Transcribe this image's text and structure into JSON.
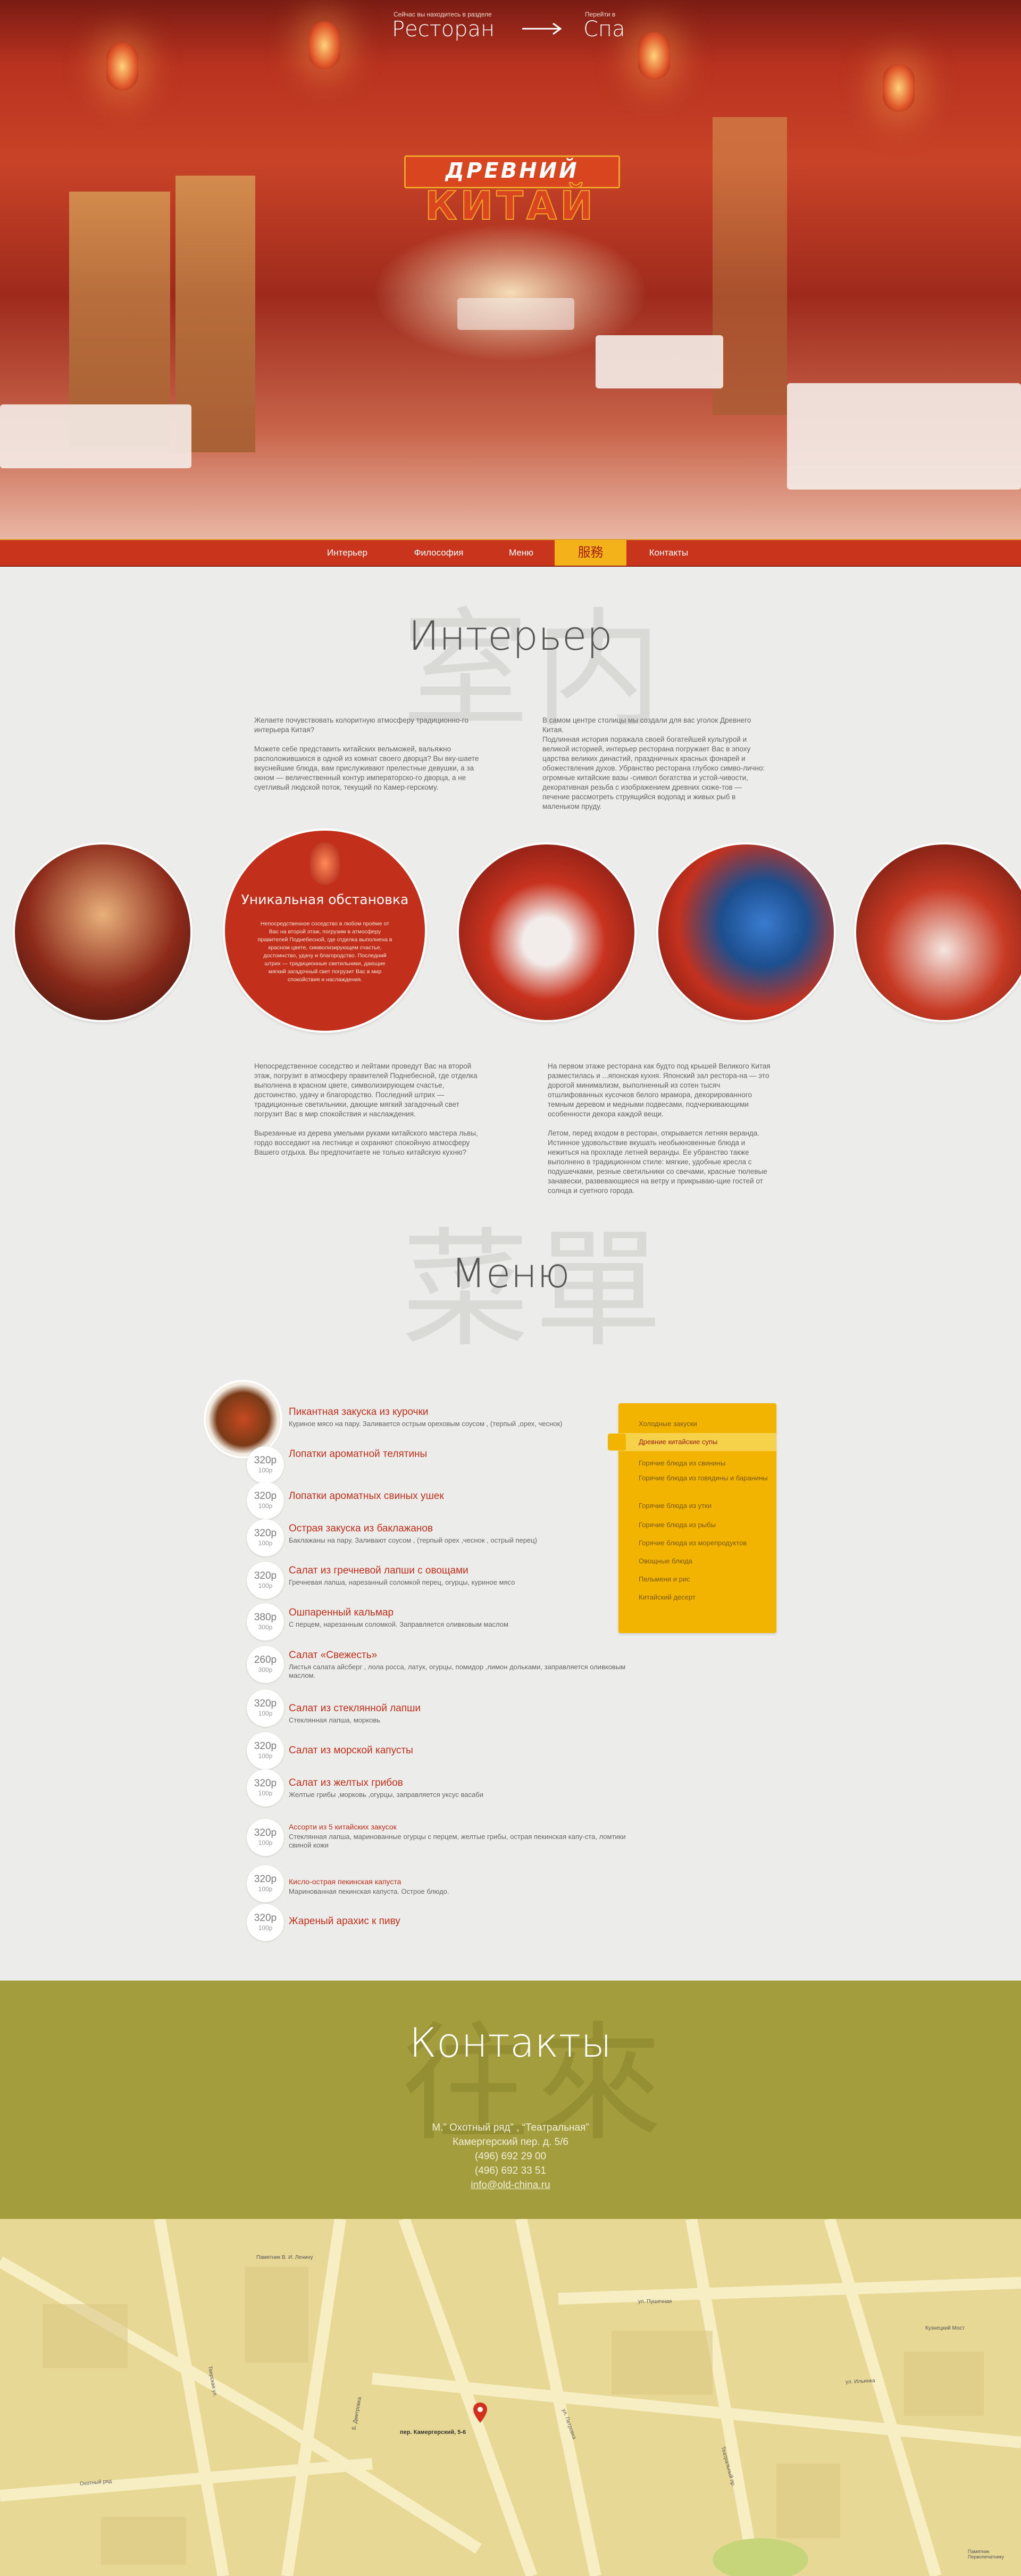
{
  "hero": {
    "left_caption": "Сейчас вы находитесь в разделе",
    "left_title": "Ресторан",
    "right_caption": "Перейти в",
    "right_title": "Спа",
    "logo_line1": "ДРЕВНИЙ",
    "logo_line2": "КИТАЙ"
  },
  "nav": {
    "items": [
      "Интерьер",
      "Философия",
      "Меню",
      "服務",
      "Контакты"
    ],
    "active_index": 3
  },
  "interior": {
    "watermark": "室内",
    "title": "Интерьер",
    "p_left": "Желаете почувствовать колоритную атмосферу традиционно-го интерьера Китая?\n\nМожете себе представить китайских вельможей, вальяжно расположившихся в одной из комнат своего дворца? Вы вку-шаете вкуснейшие блюда, вам прислуживают прелестные девушки, а за окном — величественный контур императорско-го дворца, а не суетливый людской поток, текущий по Камер-герскому.",
    "p_right": "В самом центре столицы мы создали для вас уголок Древнего Китая.\nПодлинная история поражала своей богатейшей культурой и великой историей, интерьер ресторана погружает Вас в эпоху царства великих династий, праздничных красных фонарей и обожествления духов. Убранство ресторана глубоко симво-лично: огромные китайские вазы -символ богатства и устой-чивости, декоративная резьба с изображением древних сюже-тов — печение рассмотреть струящийся водопад и живых рыб в маленьком пруду.",
    "feature_title": "Уникальная обстановка",
    "feature_text": "Непосредственное соседство в любом проёме от Вас на второй этаж, погрузим в атмосферу правителей Поднебесной, где отделка выполнена в красном цвете, символизирующем счастье, достоинство, удачу и благородство. Последний штрих — традиционные светильники, дающие мягкий загадочный свет погрузит Вас в мир спокойствия и наслаждения.",
    "p2_left": "Непосредственное соседство и лейтами проведут Вас на второй этаж, погрузит в атмосферу правителей Поднебесной, где отделка выполнена в красном цвете, символизирующем счастье, достоинство, удачу и благородство. Последний штрих — традиционные светильники, дающие мягкий загадочный свет погрузит Вас в мир спокойствия и наслаждения.\n\nВырезанные из дерева умелыми руками китайского мастера львы, гордо восседают на лестнице и охраняют спокойную атмосферу Вашего отдыха. Вы предпочитаете не только китайскую кухню?",
    "p2_right": "На первом этаже ресторана как будто под крышей Великого Китая разместилась и ...японская кухня. Японский зал рестора-на — это дорогой минимализм, выполненный из сотен тысяч отшлифованных кусочков белого мрамора, декорированного темным деревом и медными подвесами, подчеркивающими особенности декора каждой вещи.\n\nЛетом, перед входом в ресторан, открывается летняя веранда. Истинное удовольствие вкушать необыкновенные блюда и нежиться на прохладе летней веранды. Ее убранство также выполнено в традиционном стиле: мягкие, удобные кресла с подушечками, резные светильники со свечами, красные тюлевые занавески, развевающиеся на ветру и прикрываю-щие гостей от солнца и суетного города."
  },
  "menu": {
    "watermark": "菜單",
    "title": "Меню",
    "dishes": [
      {
        "price": "",
        "weight": "",
        "title": "Пикантная закуска из курочки",
        "desc": "Куриное мясо на пару. Заливается острым ореховым соусом , (терпый ,орех, чеснок)"
      },
      {
        "price": "320р",
        "weight": "100р",
        "title": "Лопатки ароматной телятины",
        "desc": ""
      },
      {
        "price": "320р",
        "weight": "100р",
        "title": "Лопатки ароматных свиных ушек",
        "desc": ""
      },
      {
        "price": "320р",
        "weight": "100р",
        "title": "Острая закуска из баклажанов",
        "desc": "Баклажаны на пару. Заливают соусом , (терпый орех ,чеснок , острый перец)"
      },
      {
        "price": "320р",
        "weight": "100р",
        "title": "Салат из гречневой лапши с овощами",
        "desc": "Гречневая лапша, нарезанный соломкой перец, огурцы, куриное мясо"
      },
      {
        "price": "380р",
        "weight": "300р",
        "title": "Ошпаренный кальмар",
        "desc": "С перцем, нарезанным соломкой. Заправляется оливковым маслом"
      },
      {
        "price": "260р",
        "weight": "300р",
        "title": "Салат «Свежесть»",
        "desc": "Листья салата айсберг , лола росса, латук, огурцы, помидор ,лимон дольками, заправляется оливковым маслом."
      },
      {
        "price": "320р",
        "weight": "100р",
        "title": "Салат из стеклянной лапши",
        "desc": "Стеклянная лапша, морковь"
      },
      {
        "price": "320р",
        "weight": "100р",
        "title": "Салат из морской капусты",
        "desc": ""
      },
      {
        "price": "320р",
        "weight": "100р",
        "title": "Салат из желтых грибов",
        "desc": "Желтые грибы ,морковь ,огурцы, заправляется уксус васаби"
      },
      {
        "price": "320р",
        "weight": "100р",
        "title": "Ассорти из 5 китайских закусок",
        "desc": "Стеклянная лапша, маринованные огурцы с перцем, желтые грибы, острая пекинская капу-ста, ломтики свиной кожи"
      },
      {
        "price": "320р",
        "weight": "100р",
        "title": "Кисло-острая пекинская капуста",
        "desc": "Маринованная пекинская капуста. Острое блюдо."
      },
      {
        "price": "320р",
        "weight": "100р",
        "title": "Жареный арахис к пиву",
        "desc": ""
      }
    ],
    "categories": [
      "Холодные закуски",
      "Древние китайские супы",
      "Горячие блюда из свинины",
      "Горячие блюда из говядины и баранины",
      "Горячие блюда из утки",
      "Горячие блюда из рыбы",
      "Горячие блюда из морепродуктов",
      "Овощные блюда",
      "Пельмени и рис",
      "Китайский десерт"
    ],
    "active_category": 1
  },
  "contacts": {
    "watermark": "往來",
    "title": "Контакты",
    "metro": "М.” Охотный ряд” , “Театральная”",
    "address": "Камергерский пер. д. 5/6",
    "phone1": "(496) 692 29 00",
    "phone2": "(496) 692 33 51",
    "email": "info@old-china.ru"
  },
  "map": {
    "marker_label": "пер. Камергерский, 5-6",
    "labels": [
      "Памятник В. И. Ленину",
      "ул. Ильинка",
      "Кузнецкий Мост",
      "Памятник Первопечатнику",
      "Тверская ул.",
      "ул. Петровка",
      "Б. Дмитровка",
      "ул. Пушечная",
      "Театральный пр.",
      "Охотный ряд"
    ]
  }
}
